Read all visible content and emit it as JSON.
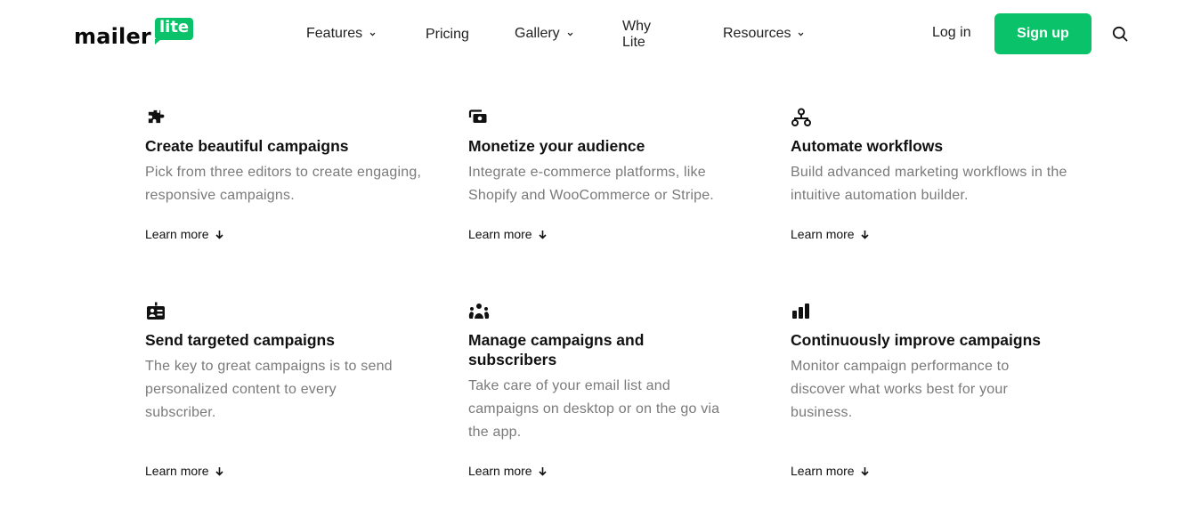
{
  "header": {
    "logo": {
      "word": "mailer",
      "badge": "lite"
    },
    "nav": [
      {
        "label": "Features",
        "has_dropdown": true
      },
      {
        "label": "Pricing",
        "has_dropdown": false
      },
      {
        "label": "Gallery",
        "has_dropdown": true
      },
      {
        "label": "Why Lite",
        "has_dropdown": false
      },
      {
        "label": "Resources",
        "has_dropdown": true
      }
    ],
    "login_label": "Log in",
    "signup_label": "Sign up",
    "search_icon": "search-icon"
  },
  "colors": {
    "brand_green": "#09c269",
    "heading": "#111111",
    "body_text": "#7a7a7a"
  },
  "features": [
    {
      "icon": "puzzle-icon",
      "title": "Create beautiful campaigns",
      "description": "Pick from three editors to create engaging, responsive campaigns.",
      "link": "Learn more"
    },
    {
      "icon": "money-icon",
      "title": "Monetize your audience",
      "description": "Integrate e-commerce platforms, like Shopify and WooCommerce or Stripe.",
      "link": "Learn more"
    },
    {
      "icon": "workflow-icon",
      "title": "Automate workflows",
      "description": "Build advanced marketing workflows in the intuitive automation builder.",
      "link": "Learn more"
    },
    {
      "icon": "id-badge-icon",
      "title": "Send targeted campaigns",
      "description": "The key to great campaigns is to send personalized content to every subscriber.",
      "link": "Learn more"
    },
    {
      "icon": "people-icon",
      "title": "Manage campaigns and subscribers",
      "description": "Take care of your email list and campaigns on desktop or on the go via the app.",
      "link": "Learn more"
    },
    {
      "icon": "bar-chart-icon",
      "title": "Continuously improve campaigns",
      "description": "Monitor campaign performance to discover what works best for your business.",
      "link": "Learn more"
    }
  ]
}
